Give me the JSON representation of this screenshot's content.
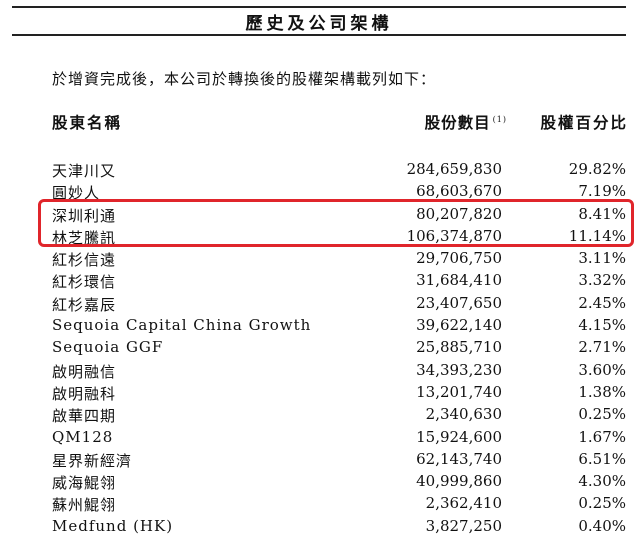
{
  "section_title": "歷史及公司架構",
  "intro_text": "於增資完成後，本公司於轉換後的股權架構載列如下：",
  "table": {
    "headers": {
      "name": "股東名稱",
      "shares": "股份數目",
      "shares_note": "(1)",
      "percent": "股權百分比"
    },
    "rows": [
      {
        "name": "天津川又",
        "shares": "284,659,830",
        "percent": "29.82%"
      },
      {
        "name": "圓妙人",
        "shares": "68,603,670",
        "percent": "7.19%"
      },
      {
        "name": "深圳利通",
        "shares": "80,207,820",
        "percent": "8.41%"
      },
      {
        "name": "林芝騰訊",
        "shares": "106,374,870",
        "percent": "11.14%"
      },
      {
        "name": "紅杉信遠",
        "shares": "29,706,750",
        "percent": "3.11%"
      },
      {
        "name": "紅杉環信",
        "shares": "31,684,410",
        "percent": "3.32%"
      },
      {
        "name": "紅杉嘉辰",
        "shares": "23,407,650",
        "percent": "2.45%"
      },
      {
        "name": "Sequoia Capital China Growth",
        "shares": "39,622,140",
        "percent": "4.15%"
      },
      {
        "name": "Sequoia GGF",
        "shares": "25,885,710",
        "percent": "2.71%"
      },
      {
        "name": "啟明融信",
        "shares": "34,393,230",
        "percent": "3.60%"
      },
      {
        "name": "啟明融科",
        "shares": "13,201,740",
        "percent": "1.38%"
      },
      {
        "name": "啟華四期",
        "shares": "2,340,630",
        "percent": "0.25%"
      },
      {
        "name": "QM128",
        "shares": "15,924,600",
        "percent": "1.67%"
      },
      {
        "name": "星界新經濟",
        "shares": "62,143,740",
        "percent": "6.51%"
      },
      {
        "name": "威海鯤翎",
        "shares": "40,999,860",
        "percent": "4.30%"
      },
      {
        "name": "蘇州鯤翎",
        "shares": "2,362,410",
        "percent": "0.25%"
      },
      {
        "name": "Medfund (HK)",
        "shares": "3,827,250",
        "percent": "0.40%"
      }
    ]
  },
  "colors": {
    "highlight": "#e0252b",
    "text": "#111111",
    "rule": "#222222"
  }
}
